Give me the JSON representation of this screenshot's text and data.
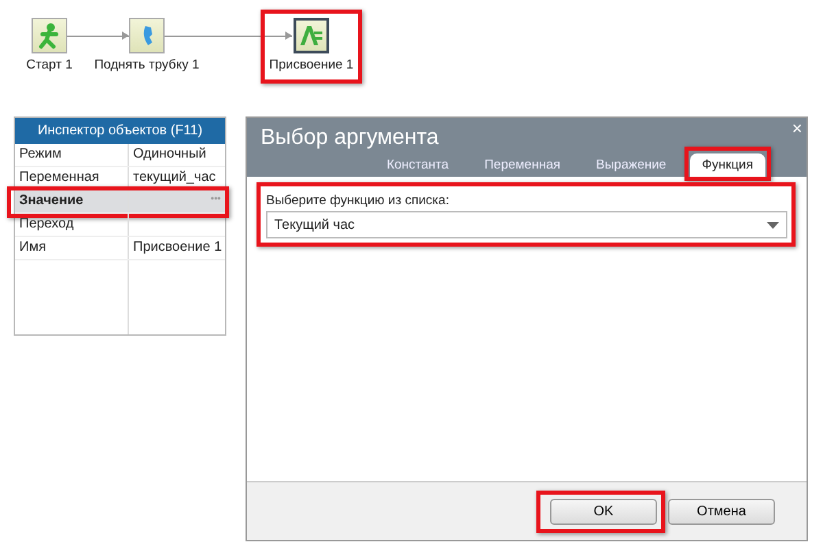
{
  "flow": {
    "nodes": [
      {
        "kind": "start",
        "label": "Старт 1",
        "selected": false,
        "highlighted": false
      },
      {
        "kind": "phone",
        "label": "Поднять трубку 1",
        "selected": false,
        "highlighted": false
      },
      {
        "kind": "assign",
        "label": "Присвоение 1",
        "selected": true,
        "highlighted": true
      }
    ]
  },
  "inspector": {
    "title": "Инспектор объектов (F11)",
    "rows": [
      {
        "name": "Режим",
        "value": "Одиночный",
        "selected": false,
        "highlighted": false
      },
      {
        "name": "Переменная",
        "value": "текущий_час",
        "selected": false,
        "highlighted": false
      },
      {
        "name": "Значение",
        "button": "•••",
        "selected": true,
        "highlighted": true
      },
      {
        "name": "Переход",
        "selected": false,
        "highlighted": false
      },
      {
        "name": "Имя",
        "value": "Присвоение 1",
        "selected": false,
        "highlighted": false
      }
    ]
  },
  "dialog": {
    "title": "Выбор аргумента",
    "close": "×",
    "tabs": [
      {
        "label": "Константа",
        "selected": false,
        "highlighted": false
      },
      {
        "label": "Переменная",
        "selected": false,
        "highlighted": false
      },
      {
        "label": "Выражение",
        "selected": false,
        "highlighted": false
      },
      {
        "label": "Функция",
        "selected": true,
        "highlighted": true
      }
    ],
    "field_label": "Выберите функцию из списка:",
    "field_value": "Текущий час",
    "field_highlighted": true,
    "buttons": [
      {
        "label": "OK",
        "highlighted": true
      },
      {
        "label": "Отмена",
        "highlighted": false
      }
    ]
  }
}
